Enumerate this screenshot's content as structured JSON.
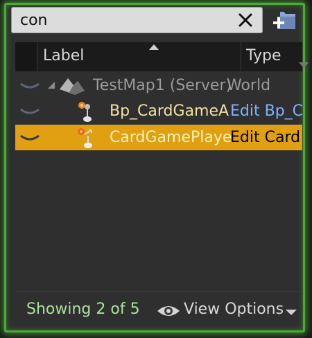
{
  "search": {
    "value": "con",
    "clear_icon": "close-icon"
  },
  "toolbar": {
    "new_folder_icon": "new-folder-icon"
  },
  "columns": {
    "label": "Label",
    "type": "Type"
  },
  "rows": [
    {
      "label": "TestMap1 (Server)",
      "type": "World",
      "label_color": "#9a9a9a",
      "type_color": "#9a9a9a",
      "selected": false
    },
    {
      "label": "Bp_CardGameA",
      "type": "Edit Bp_C",
      "label_color": "#f0e2a0",
      "type_color": "#7fb1ff",
      "selected": false
    },
    {
      "label": "CardGamePlaye",
      "type": "Edit Card",
      "label_color": "#fff2b8",
      "type_color": "#000000",
      "selected": true
    }
  ],
  "footer": {
    "count": "Showing 2 of 5",
    "view_options": "View Options"
  },
  "colors": {
    "accent_border": "#4ea83a",
    "selection": "#e0a012",
    "status_green": "#a9e39a"
  }
}
